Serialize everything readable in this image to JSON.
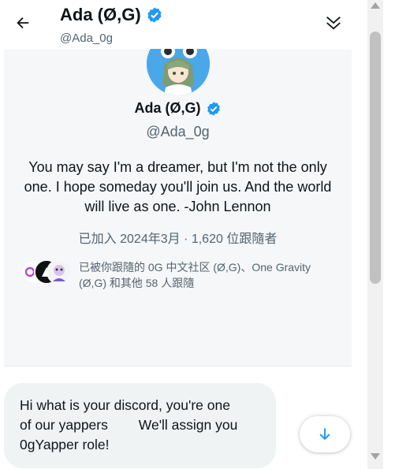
{
  "header": {
    "name": "Ada (Ø,G)",
    "handle": "@Ada_0g",
    "back_icon": "arrow-left-icon",
    "collapse_icon": "double-chevron-down-icon"
  },
  "profile": {
    "name": "Ada (Ø,G)",
    "handle": "@Ada_0g",
    "bio": "You may say I'm a dreamer, but I'm not the only one. I hope someday you'll join us. And the world will live as one. -John Lennon",
    "joined": "已加入 2024年3月 · 1,620 位跟隨者",
    "followers_known": "已被你跟隨的 0G 中文社区 (Ø,G)、One Gravity (Ø,G) 和其他 58 人跟隨",
    "follower_avatars": [
      "0g-logo",
      "dark-avatar",
      "cartoon-avatar"
    ]
  },
  "message": {
    "text": "Hi what is your discord, you're one\nof our yappers        We'll assign you\n0gYapper role!"
  },
  "colors": {
    "verified_blue": "#1d9bf0",
    "card_bg": "#f5f7f8",
    "bubble_bg": "#eff3f4",
    "secondary_text": "#536471"
  }
}
